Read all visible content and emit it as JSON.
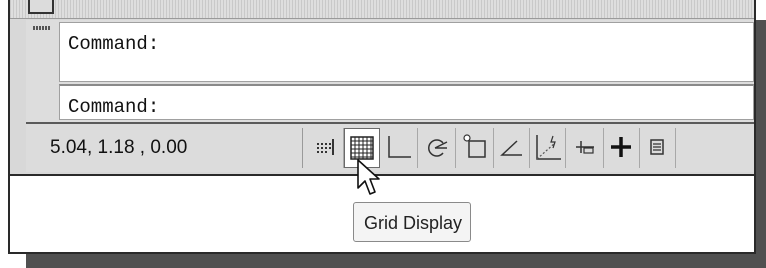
{
  "command_window": {
    "history_text": "Command:",
    "prompt_text": "Command:"
  },
  "status_bar": {
    "coordinates": "5.04, 1.18 , 0.00",
    "toggles": [
      {
        "name": "infer-constraints-icon"
      },
      {
        "name": "grid-display-icon",
        "state": "pressed"
      },
      {
        "name": "ortho-mode-icon"
      },
      {
        "name": "polar-tracking-icon"
      },
      {
        "name": "object-snap-icon"
      },
      {
        "name": "object-snap-tracking-icon"
      },
      {
        "name": "dynamic-ucs-icon"
      },
      {
        "name": "dynamic-input-icon"
      },
      {
        "name": "lineweight-icon"
      },
      {
        "name": "quick-properties-icon"
      }
    ]
  },
  "tooltip": {
    "text": "Grid Display"
  },
  "colors": {
    "panel": "#dcdcdc",
    "text": "#111111",
    "shadow": "#505050"
  }
}
